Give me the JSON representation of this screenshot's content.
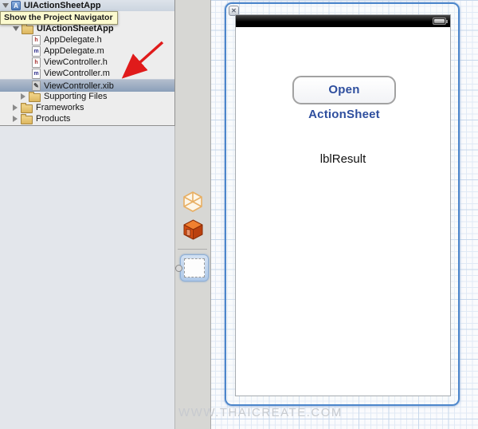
{
  "tooltip": {
    "text": "Show the Project Navigator"
  },
  "navigator": {
    "project": {
      "label": "UIActionSheetApp",
      "icon_letter": "A"
    },
    "group": {
      "label": "UIActionSheetApp"
    },
    "files": [
      {
        "label": "AppDelegate.h",
        "badge": "h"
      },
      {
        "label": "AppDelegate.m",
        "badge": "m"
      },
      {
        "label": "ViewController.h",
        "badge": "h"
      },
      {
        "label": "ViewController.m",
        "badge": "m"
      },
      {
        "label": "ViewController.xib",
        "badge": "✎"
      }
    ],
    "folders": [
      {
        "label": "Supporting Files"
      },
      {
        "label": "Frameworks"
      },
      {
        "label": "Products"
      }
    ]
  },
  "canvas": {
    "button_label": "Open ActionSheet",
    "result_label": "lblResult",
    "close_glyph": "✕"
  },
  "watermark": "WWW.THAICREATE.COM",
  "colors": {
    "selection_top": "#B2BDCD",
    "selection_bottom": "#8B9FB9",
    "window_border": "#4C86CB",
    "button_text": "#2E4E9E",
    "arrow": "#E01B1B",
    "tooltip_bg": "#FCFACF",
    "grid_minor": "#E1EAF5",
    "grid_major": "#C7D7EB"
  }
}
